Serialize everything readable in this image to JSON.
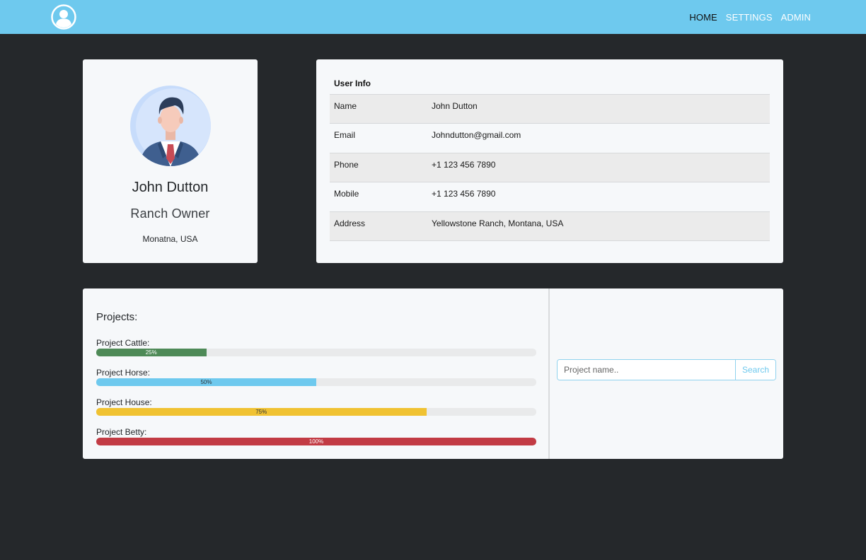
{
  "nav": {
    "logo_icon": "user-circle-icon",
    "links": [
      {
        "label": "HOME",
        "active": true
      },
      {
        "label": "SETTINGS",
        "active": false
      },
      {
        "label": "ADMIN",
        "active": false
      }
    ]
  },
  "profile": {
    "avatar_icon": "businessman-avatar",
    "name": "John Dutton",
    "role": "Ranch Owner",
    "location": "Monatna, USA"
  },
  "user_info": {
    "title": "User Info",
    "rows": [
      {
        "key": "Name",
        "value": "John Dutton"
      },
      {
        "key": "Email",
        "value": "Johndutton@gmail.com"
      },
      {
        "key": "Phone",
        "value": "+1 123 456 7890"
      },
      {
        "key": "Mobile",
        "value": "+1 123 456 7890"
      },
      {
        "key": "Address",
        "value": "Yellowstone Ranch, Montana, USA"
      }
    ]
  },
  "projects": {
    "title": "Projects:",
    "items": [
      {
        "label": "Project Cattle:",
        "progress": 25,
        "progress_label": "25%",
        "color": "#4e8a57"
      },
      {
        "label": "Project Horse:",
        "progress": 50,
        "progress_label": "50%",
        "color": "#6ec9ee"
      },
      {
        "label": "Project House:",
        "progress": 75,
        "progress_label": "75%",
        "color": "#f0c232"
      },
      {
        "label": "Project Betty:",
        "progress": 100,
        "progress_label": "100%",
        "color": "#c23b44"
      }
    ]
  },
  "search": {
    "placeholder": "Project name..",
    "value": "",
    "button_label": "Search"
  },
  "colors": {
    "navbar": "#6ec9ee",
    "background": "#25282b",
    "card": "#f6f8fa"
  }
}
